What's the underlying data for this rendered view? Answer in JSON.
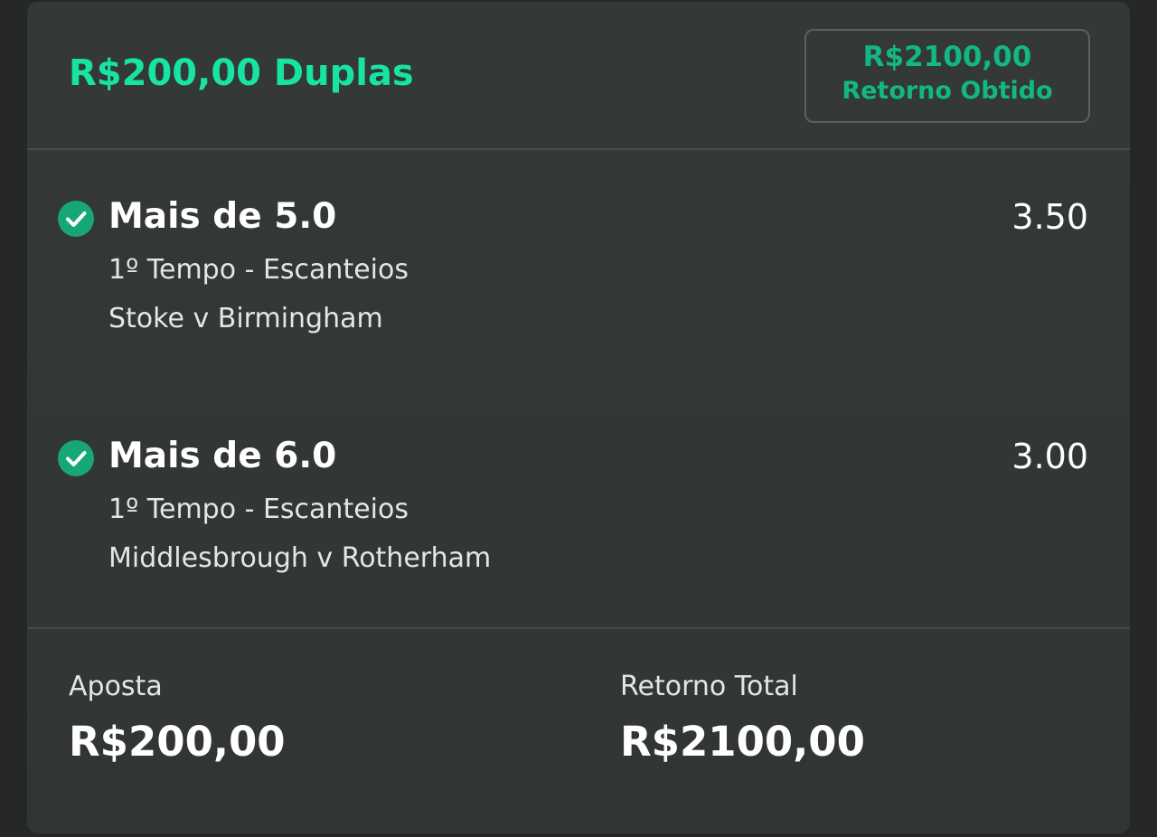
{
  "bet": {
    "title": "R$200,00 Duplas",
    "return_amount": "R$2100,00",
    "return_label": "Retorno Obtido"
  },
  "selections": [
    {
      "status_icon": "check-circle-icon",
      "title": "Mais de 5.0",
      "odds": "3.50",
      "market": "1º Tempo - Escanteios",
      "event": "Stoke v Birmingham"
    },
    {
      "status_icon": "check-circle-icon",
      "title": "Mais de 6.0",
      "odds": "3.00",
      "market": "1º Tempo - Escanteios",
      "event": "Middlesbrough v Rotherham"
    }
  ],
  "summary": {
    "stake_label": "Aposta",
    "stake_value": "R$200,00",
    "total_return_label": "Retorno Total",
    "total_return_value": "R$2100,00"
  },
  "colors": {
    "accent": "#17e3a3",
    "win_green": "#16a677",
    "card_bg": "#333735",
    "page_bg": "#252826"
  }
}
